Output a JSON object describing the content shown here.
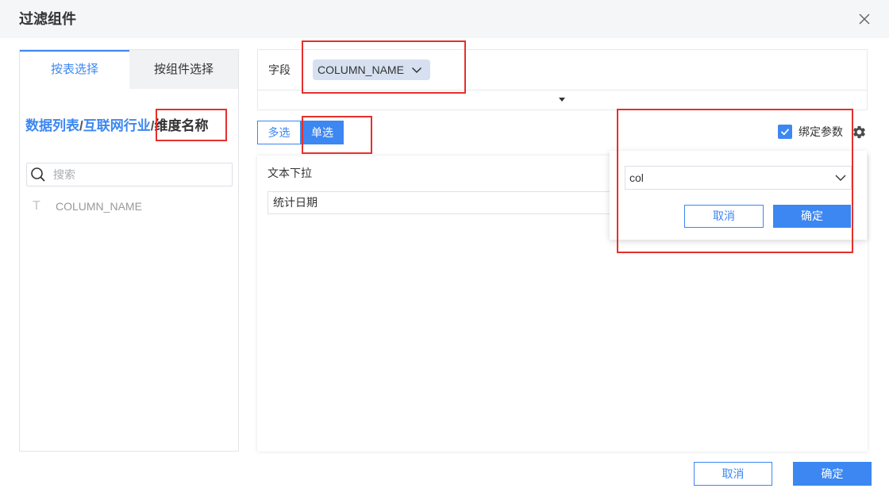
{
  "dialog": {
    "title": "过滤组件",
    "close_icon": "close-icon"
  },
  "left_panel": {
    "tabs": [
      {
        "label": "按表选择",
        "active": true
      },
      {
        "label": "按组件选择",
        "active": false
      }
    ],
    "breadcrumb": {
      "items": [
        "数据列表",
        "互联网行业",
        "维度名称"
      ],
      "separator": "/"
    },
    "search": {
      "icon": "search-icon",
      "placeholder": "搜索",
      "value": ""
    },
    "fields": [
      {
        "type_icon": "T",
        "name": "COLUMN_NAME"
      }
    ]
  },
  "field_selector": {
    "label": "字段",
    "selected_tag": "COLUMN_NAME",
    "tag_icon": "chevron-down-icon",
    "expand_icon": "caret-down-icon"
  },
  "selection_mode": {
    "options": [
      {
        "label": "多选",
        "active": false
      },
      {
        "label": "单选",
        "active": true
      }
    ]
  },
  "bind_param": {
    "checked": true,
    "label": "绑定参数",
    "settings_icon": "gear-icon"
  },
  "param_popup": {
    "select_value": "col",
    "select_icon": "chevron-down-icon",
    "cancel_label": "取消",
    "confirm_label": "确定"
  },
  "widget": {
    "label": "文本下拉",
    "value": "统计日期"
  },
  "footer": {
    "cancel_label": "取消",
    "confirm_label": "确定"
  },
  "colors": {
    "accent": "#3c87f2",
    "header_bg": "#f5f6f8",
    "annotation": "#e5302b"
  }
}
